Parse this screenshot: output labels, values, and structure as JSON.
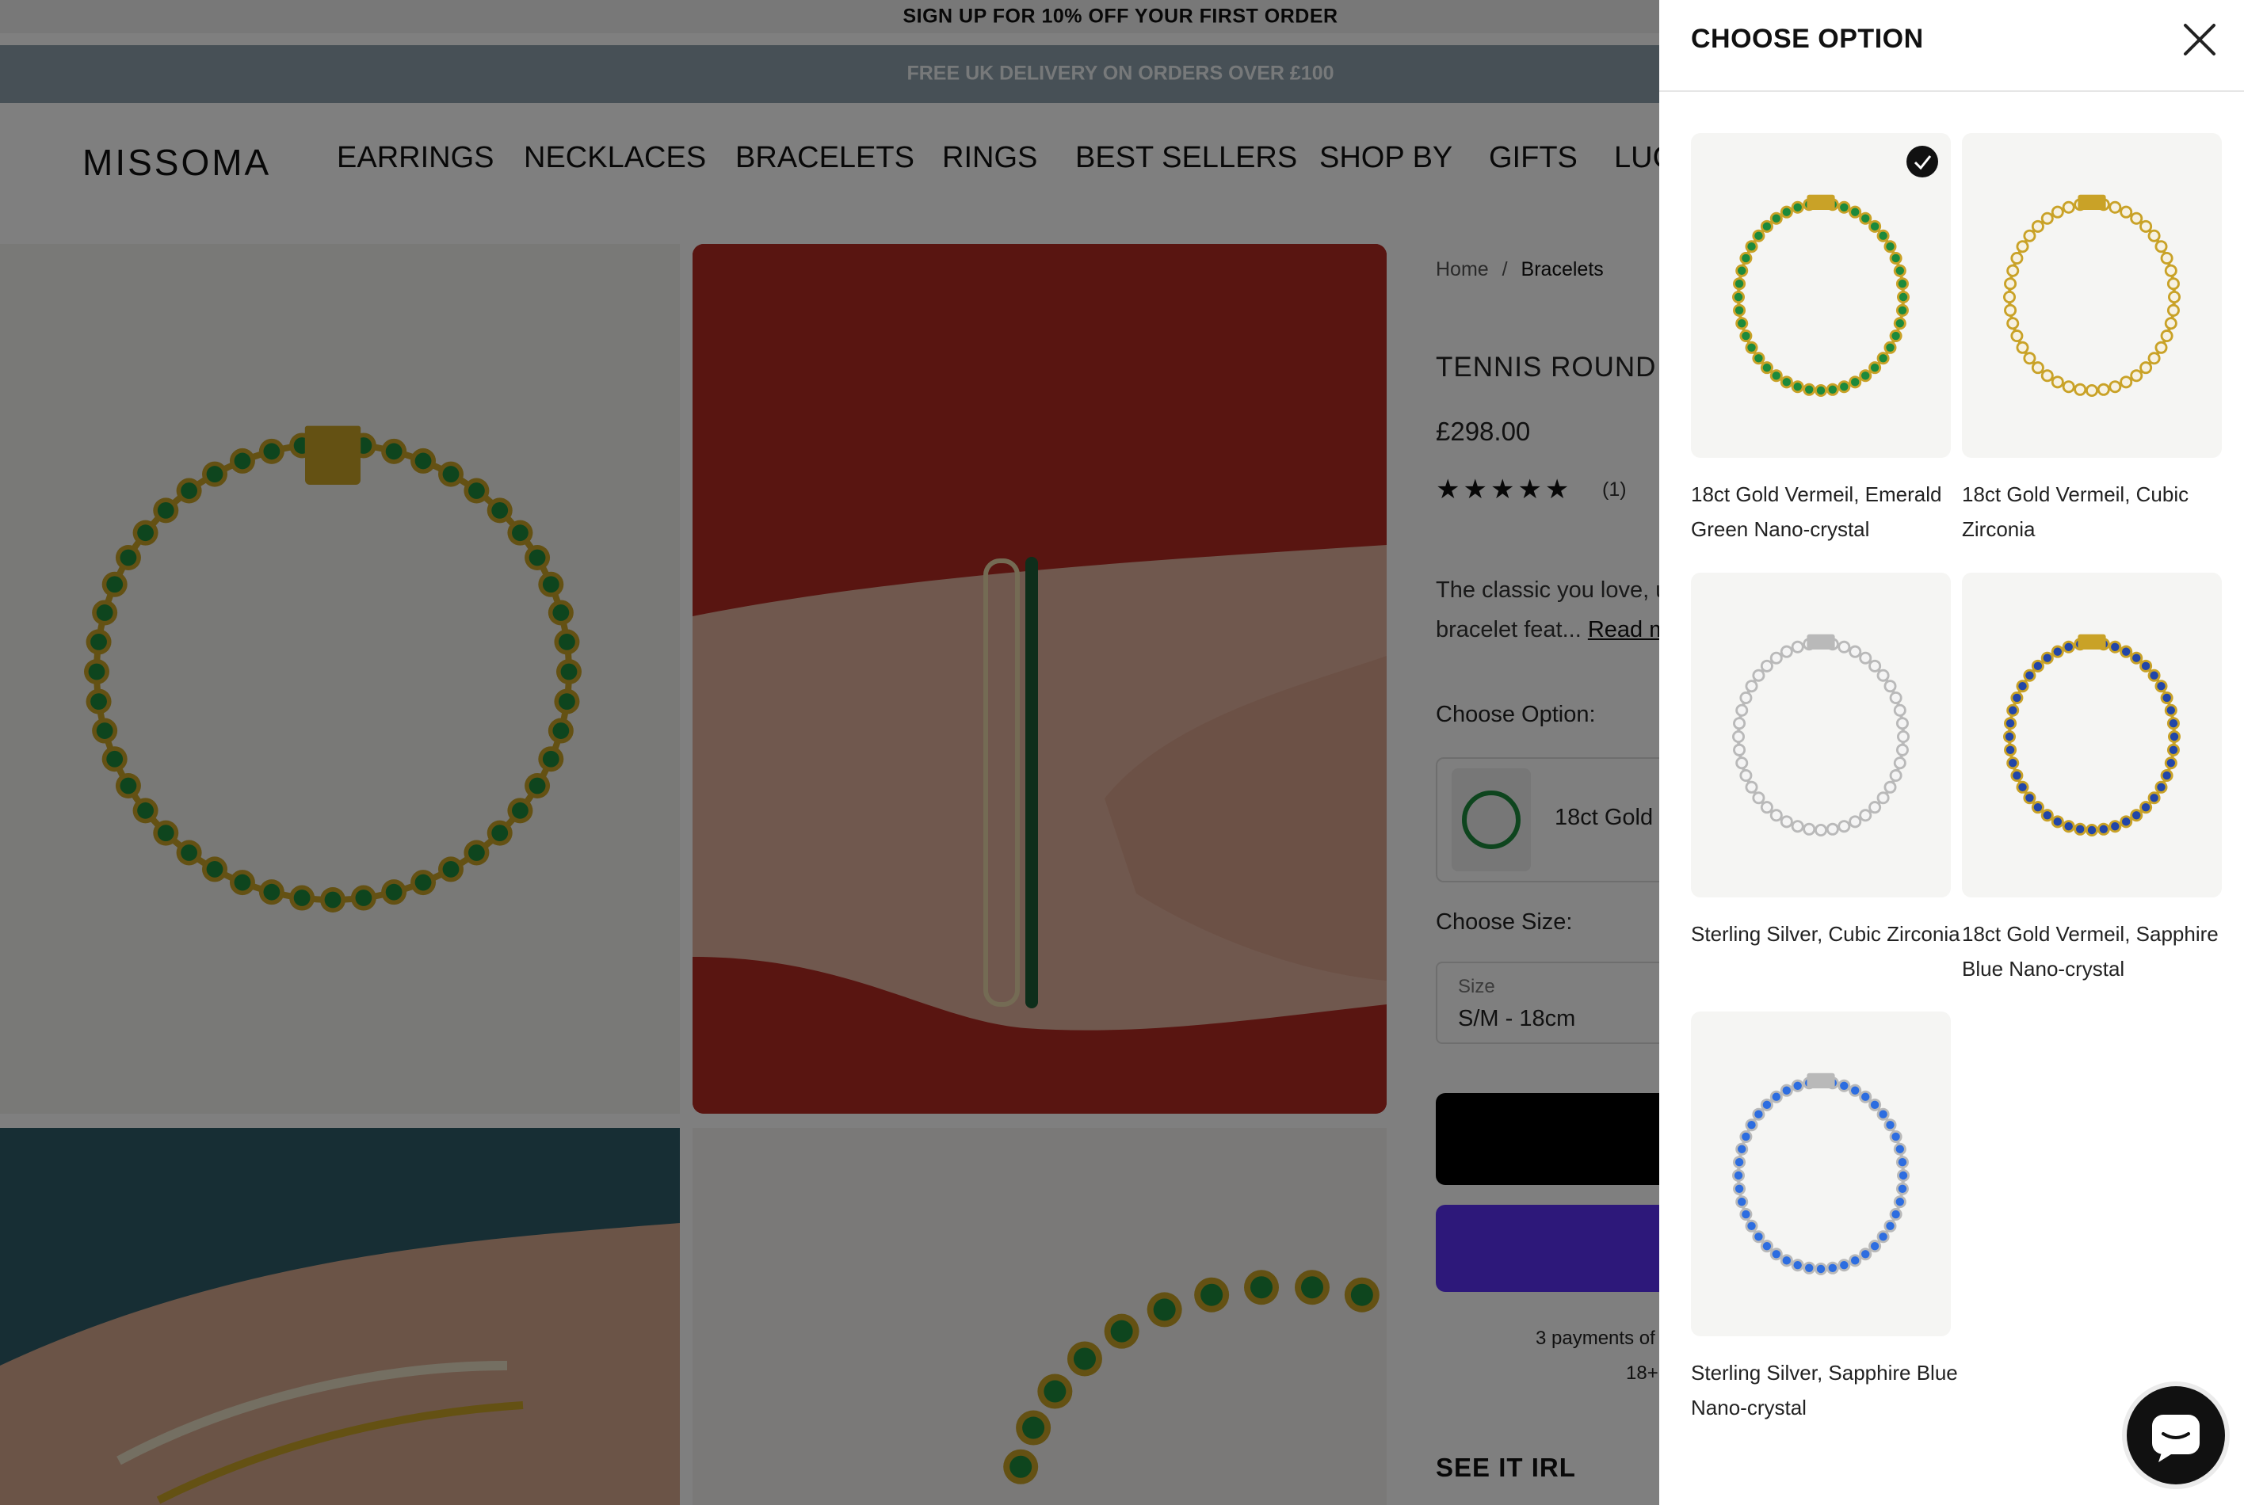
{
  "promo": {
    "top": "SIGN UP FOR 10% OFF YOUR FIRST ORDER",
    "delivery": "FREE UK DELIVERY ON ORDERS OVER £100"
  },
  "header": {
    "logo": "MISSOMA",
    "nav": [
      "EARRINGS",
      "NECKLACES",
      "BRACELETS",
      "RINGS",
      "BEST SELLERS",
      "SHOP BY",
      "GIFTS",
      "LUC"
    ]
  },
  "breadcrumb": {
    "home": "Home",
    "sep": "/",
    "current": "Bracelets"
  },
  "product": {
    "title": "TENNIS ROUND BR",
    "price": "£298.00",
    "stars": "★★★★★",
    "rating": 5,
    "review_count": "(1)",
    "description_line1": "The classic you love, u",
    "description_line2": "bracelet feat...",
    "read_more": "Read m",
    "choose_option_label": "Choose Option:",
    "selected_option": "18ct Gold",
    "choose_size_label": "Choose Size:",
    "size_field_label": "Size",
    "size_value": "S/M - 18cm",
    "payments_line1": "3 payments of",
    "payments_line2": "18+",
    "see_it_irl": "SEE IT IRL"
  },
  "drawer": {
    "title": "CHOOSE OPTION",
    "options": [
      {
        "label": "18ct Gold Vermeil, Emerald Green Nano-crystal",
        "metal": "#c9a227",
        "stone": "#1c8a3c",
        "selected": true
      },
      {
        "label": "18ct Gold Vermeil, Cubic Zirconia",
        "metal": "#c9a227",
        "stone": "#f6f1e2",
        "selected": false
      },
      {
        "label": "Sterling Silver, Cubic Zirconia",
        "metal": "#b9b9b9",
        "stone": "#f4f4f4",
        "selected": false
      },
      {
        "label": "18ct Gold Vermeil, Sapphire Blue Nano-crystal",
        "metal": "#c9a227",
        "stone": "#2246a8",
        "selected": false
      },
      {
        "label": "Sterling Silver, Sapphire Blue Nano-crystal",
        "metal": "#b9b9b9",
        "stone": "#2d6de0",
        "selected": false
      }
    ]
  },
  "colors": {
    "overlay": "rgba(0,0,0,0.5)",
    "emerald": "#1c8a3c",
    "gold": "#c9a227",
    "shop_pay": "#5a31f4"
  }
}
